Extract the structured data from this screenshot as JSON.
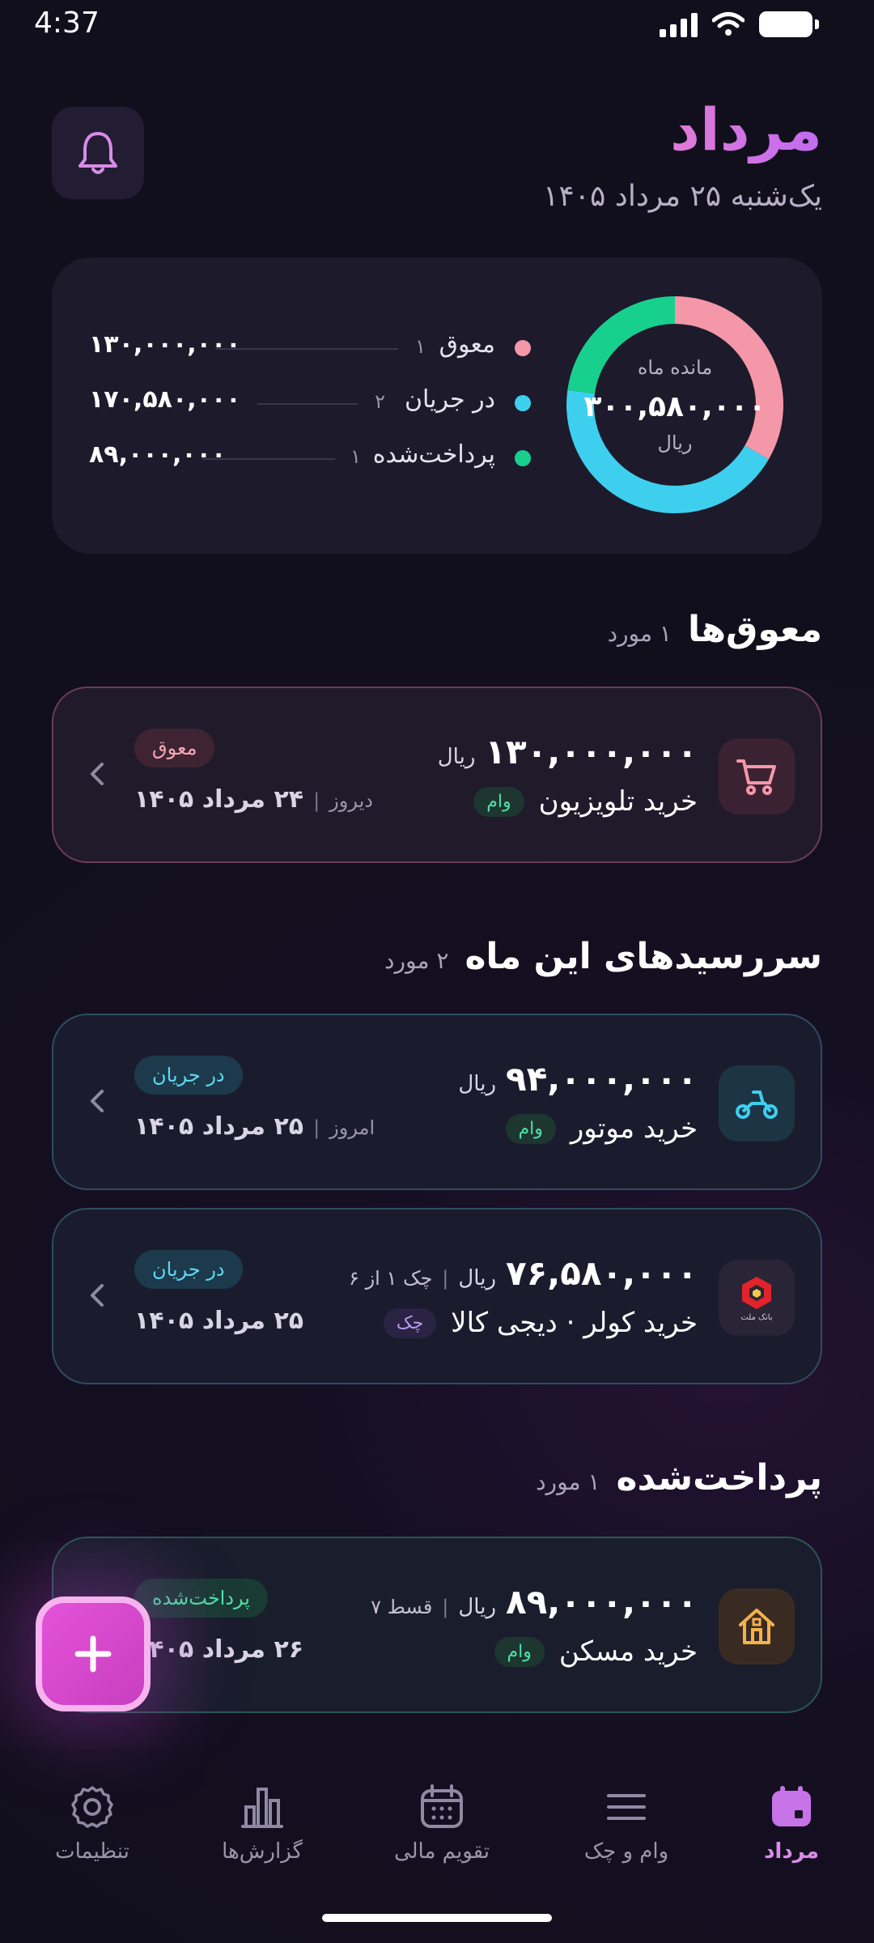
{
  "status_bar": {
    "time": "4:37"
  },
  "header": {
    "title": "مرداد",
    "date": "یک‌شنبه ۲۵ مرداد ۱۴۰۵"
  },
  "summary": {
    "center_caption": "مانده ماه",
    "center_value": "۳۰۰,۵۸۰,۰۰۰",
    "center_unit": "ریال",
    "legend": [
      {
        "name": "معوق",
        "count": "۱",
        "amount": "۱۳۰,۰۰۰,۰۰۰",
        "color": "#f497a8"
      },
      {
        "name": "در جریان",
        "count": "۲",
        "amount": "۱۷۰,۵۸۰,۰۰۰",
        "color": "#3ecfee"
      },
      {
        "name": "پرداخت‌شده",
        "count": "۱",
        "amount": "۸۹,۰۰۰,۰۰۰",
        "color": "#18d08e"
      }
    ],
    "shares": [
      130000000,
      170580000,
      89000000
    ]
  },
  "sections": {
    "overdue": {
      "title": "معوق‌ها",
      "count": "۱ مورد"
    },
    "this_month": {
      "title": "سررسیدهای این ماه",
      "count": "۲ مورد"
    },
    "paid": {
      "title": "پرداخت‌شده",
      "count": "۱ مورد"
    }
  },
  "items": [
    {
      "amount": "۱۳۰,۰۰۰,۰۰۰",
      "unit": "ریال",
      "name": "خرید تلویزیون",
      "type": "وام",
      "status": "معوق",
      "due": "۲۴ مرداد ۱۴۰۵",
      "relative": "دیروز",
      "icon": "cart-icon"
    },
    {
      "amount": "۹۴,۰۰۰,۰۰۰",
      "unit": "ریال",
      "name": "خرید موتور",
      "type": "وام",
      "status": "در جریان",
      "due": "۲۵ مرداد ۱۴۰۵",
      "relative": "امروز",
      "icon": "scooter-icon"
    },
    {
      "amount": "۷۶,۵۸۰,۰۰۰",
      "unit": "ریال",
      "extra": "چک ۱ از ۶",
      "name": "خرید کولر · دیجی کالا",
      "type": "چک",
      "status": "در جریان",
      "due": "۲۵ مرداد ۱۴۰۵",
      "icon": "bank-mellat-logo-icon",
      "logo_text": "بانک ملت"
    },
    {
      "amount": "۸۹,۰۰۰,۰۰۰",
      "unit": "ریال",
      "extra": "قسط ۷",
      "name": "خرید مسکن",
      "type": "وام",
      "status": "پرداخت‌شده",
      "due": "۲۶ مرداد ۱۴۰۵",
      "icon": "house-icon"
    }
  ],
  "nav": {
    "items": [
      {
        "label": "مرداد",
        "icon": "calendar-month-icon",
        "active": true
      },
      {
        "label": "وام و چک",
        "icon": "list-icon"
      },
      {
        "label": "تقویم مالی",
        "icon": "calendar-icon"
      },
      {
        "label": "گزارش‌ها",
        "icon": "bar-chart-icon"
      },
      {
        "label": "تنظیمات",
        "icon": "gear-icon"
      }
    ]
  },
  "colors": {
    "accent": "#d98be8",
    "overdue": "#f497a8",
    "in_flow": "#3ecfee",
    "paid": "#18d08e"
  }
}
